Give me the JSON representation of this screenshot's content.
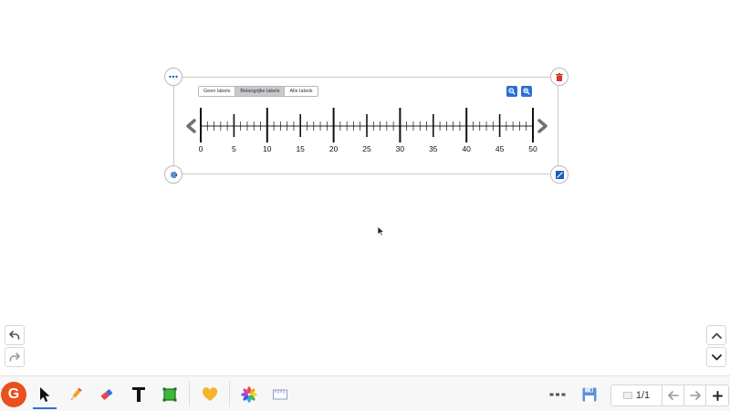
{
  "number_line": {
    "label_modes": [
      {
        "label": "Geen labels",
        "active": false
      },
      {
        "label": "Belangrijke labels",
        "active": true
      },
      {
        "label": "Alle labels",
        "active": false
      }
    ],
    "min": 0,
    "max": 50,
    "minor_step": 1,
    "major_step": 5,
    "labels": [
      "0",
      "5",
      "10",
      "15",
      "20",
      "25",
      "30",
      "35",
      "40",
      "45",
      "50"
    ]
  },
  "page_nav": {
    "page_indicator": "1/1"
  },
  "colors": {
    "accent": "#2a6fd6",
    "logo": "#ea4f1c",
    "delete": "#d23b2a"
  },
  "icons": {
    "corner_menu": "more-dots-icon",
    "corner_delete": "trash-icon",
    "corner_settings": "gear-icon",
    "corner_resize": "resize-icon",
    "zoom_out": "zoom-out-icon",
    "zoom_in": "zoom-in-icon",
    "undo": "undo-icon",
    "redo": "redo-icon",
    "scroll_up": "chevron-up-icon",
    "scroll_down": "chevron-down-icon",
    "logo": "G",
    "select": "cursor-arrow-icon",
    "pen": "pencil-icon",
    "eraser": "eraser-icon",
    "text": "text-icon",
    "shape": "shape-icon",
    "heart": "heart-icon",
    "tools": "tools-flower-icon",
    "ruler": "ruler-icon",
    "more": "more-dots-icon",
    "save": "save-icon",
    "prev": "arrow-left-icon",
    "next": "arrow-right-icon",
    "add": "plus-icon"
  }
}
